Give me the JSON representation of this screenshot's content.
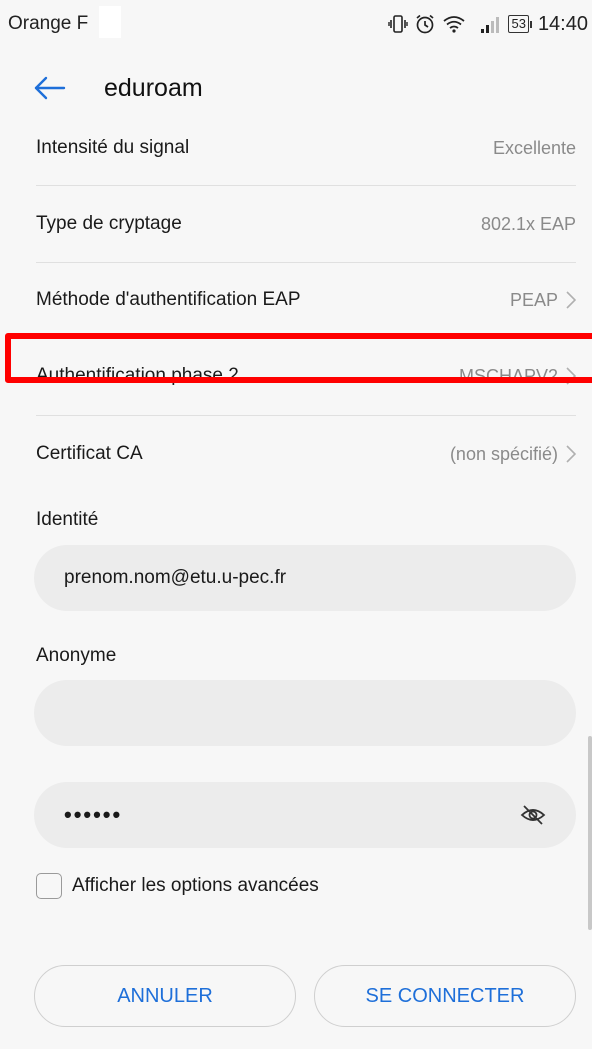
{
  "status_bar": {
    "carrier": "Orange F",
    "battery": "53",
    "time": "14:40"
  },
  "header": {
    "title": "eduroam",
    "back_icon": "arrow-left-icon"
  },
  "rows": [
    {
      "label": "Intensité du signal",
      "value": "Excellente",
      "chevron": false
    },
    {
      "label": "Type de cryptage",
      "value": "802.1x EAP",
      "chevron": false
    },
    {
      "label": "Méthode d'authentification EAP",
      "value": "PEAP",
      "chevron": true
    },
    {
      "label": "Authentification phase 2",
      "value": "MSCHAPV2",
      "chevron": true,
      "highlighted": true
    },
    {
      "label": "Certificat CA",
      "value": "(non spécifié)",
      "chevron": true
    }
  ],
  "identity": {
    "label": "Identité",
    "value": "prenom.nom@etu.u-pec.fr"
  },
  "anonymous": {
    "label": "Anonyme",
    "value": ""
  },
  "password": {
    "value": "••••••"
  },
  "advanced": {
    "label": "Afficher les options avancées",
    "checked": false
  },
  "buttons": {
    "cancel": "ANNULER",
    "connect": "SE CONNECTER"
  },
  "colors": {
    "accent": "#1e6fd9",
    "highlight": "#ff0000",
    "background": "#f7f7f7",
    "input_bg": "#ececec"
  }
}
